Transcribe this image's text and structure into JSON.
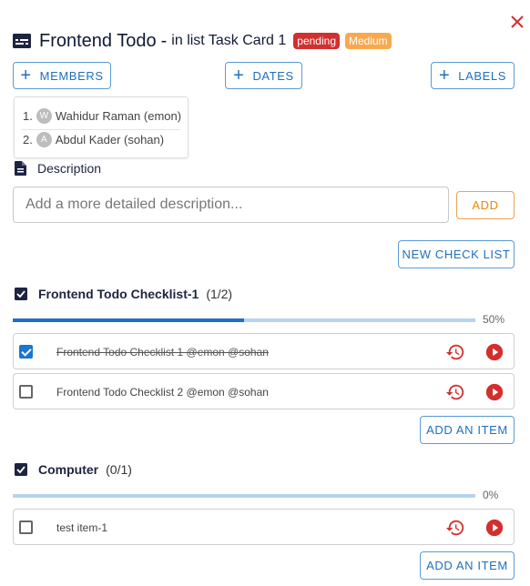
{
  "title": {
    "main": "Frontend Todo",
    "separator": "-",
    "sub": "in list Task Card 1",
    "badges": [
      "pending",
      "Medium"
    ]
  },
  "actions": {
    "members": "MEMBERS",
    "dates": "DATES",
    "labels": "LABELS"
  },
  "members": [
    {
      "number": "1.",
      "initial": "W",
      "name": "Wahidur Raman (emon)"
    },
    {
      "number": "2.",
      "initial": "A",
      "name": "Abdul Kader (sohan)"
    }
  ],
  "description": {
    "heading": "Description",
    "placeholder": "Add a more detailed description...",
    "add_label": "ADD"
  },
  "new_checklist_label": "NEW CHECK LIST",
  "checklists": [
    {
      "title": "Frontend Todo Checklist-1",
      "count": "(1/2)",
      "progress_percent": 50,
      "progress_label": "50%",
      "items": [
        {
          "text": "Frontend Todo Checklist 1 @emon @sohan",
          "checked": true
        },
        {
          "text": "Frontend Todo Checklist 2 @emon @sohan",
          "checked": false
        }
      ],
      "add_item_label": "ADD AN ITEM"
    },
    {
      "title": "Computer",
      "count": "(0/1)",
      "progress_percent": 0,
      "progress_label": "0%",
      "items": [
        {
          "text": "test item-1",
          "checked": false
        }
      ],
      "add_item_label": "ADD AN ITEM"
    }
  ],
  "colors": {
    "accent": "#1f6fc9",
    "danger": "#d32f2f",
    "warning": "#f7a950",
    "progress_track": "#b7d3ee"
  },
  "icons": {
    "close": "close-icon",
    "card": "card-icon",
    "description": "description-icon",
    "history": "history-icon",
    "play": "play-icon",
    "checkbox": "checkbox-icon"
  }
}
